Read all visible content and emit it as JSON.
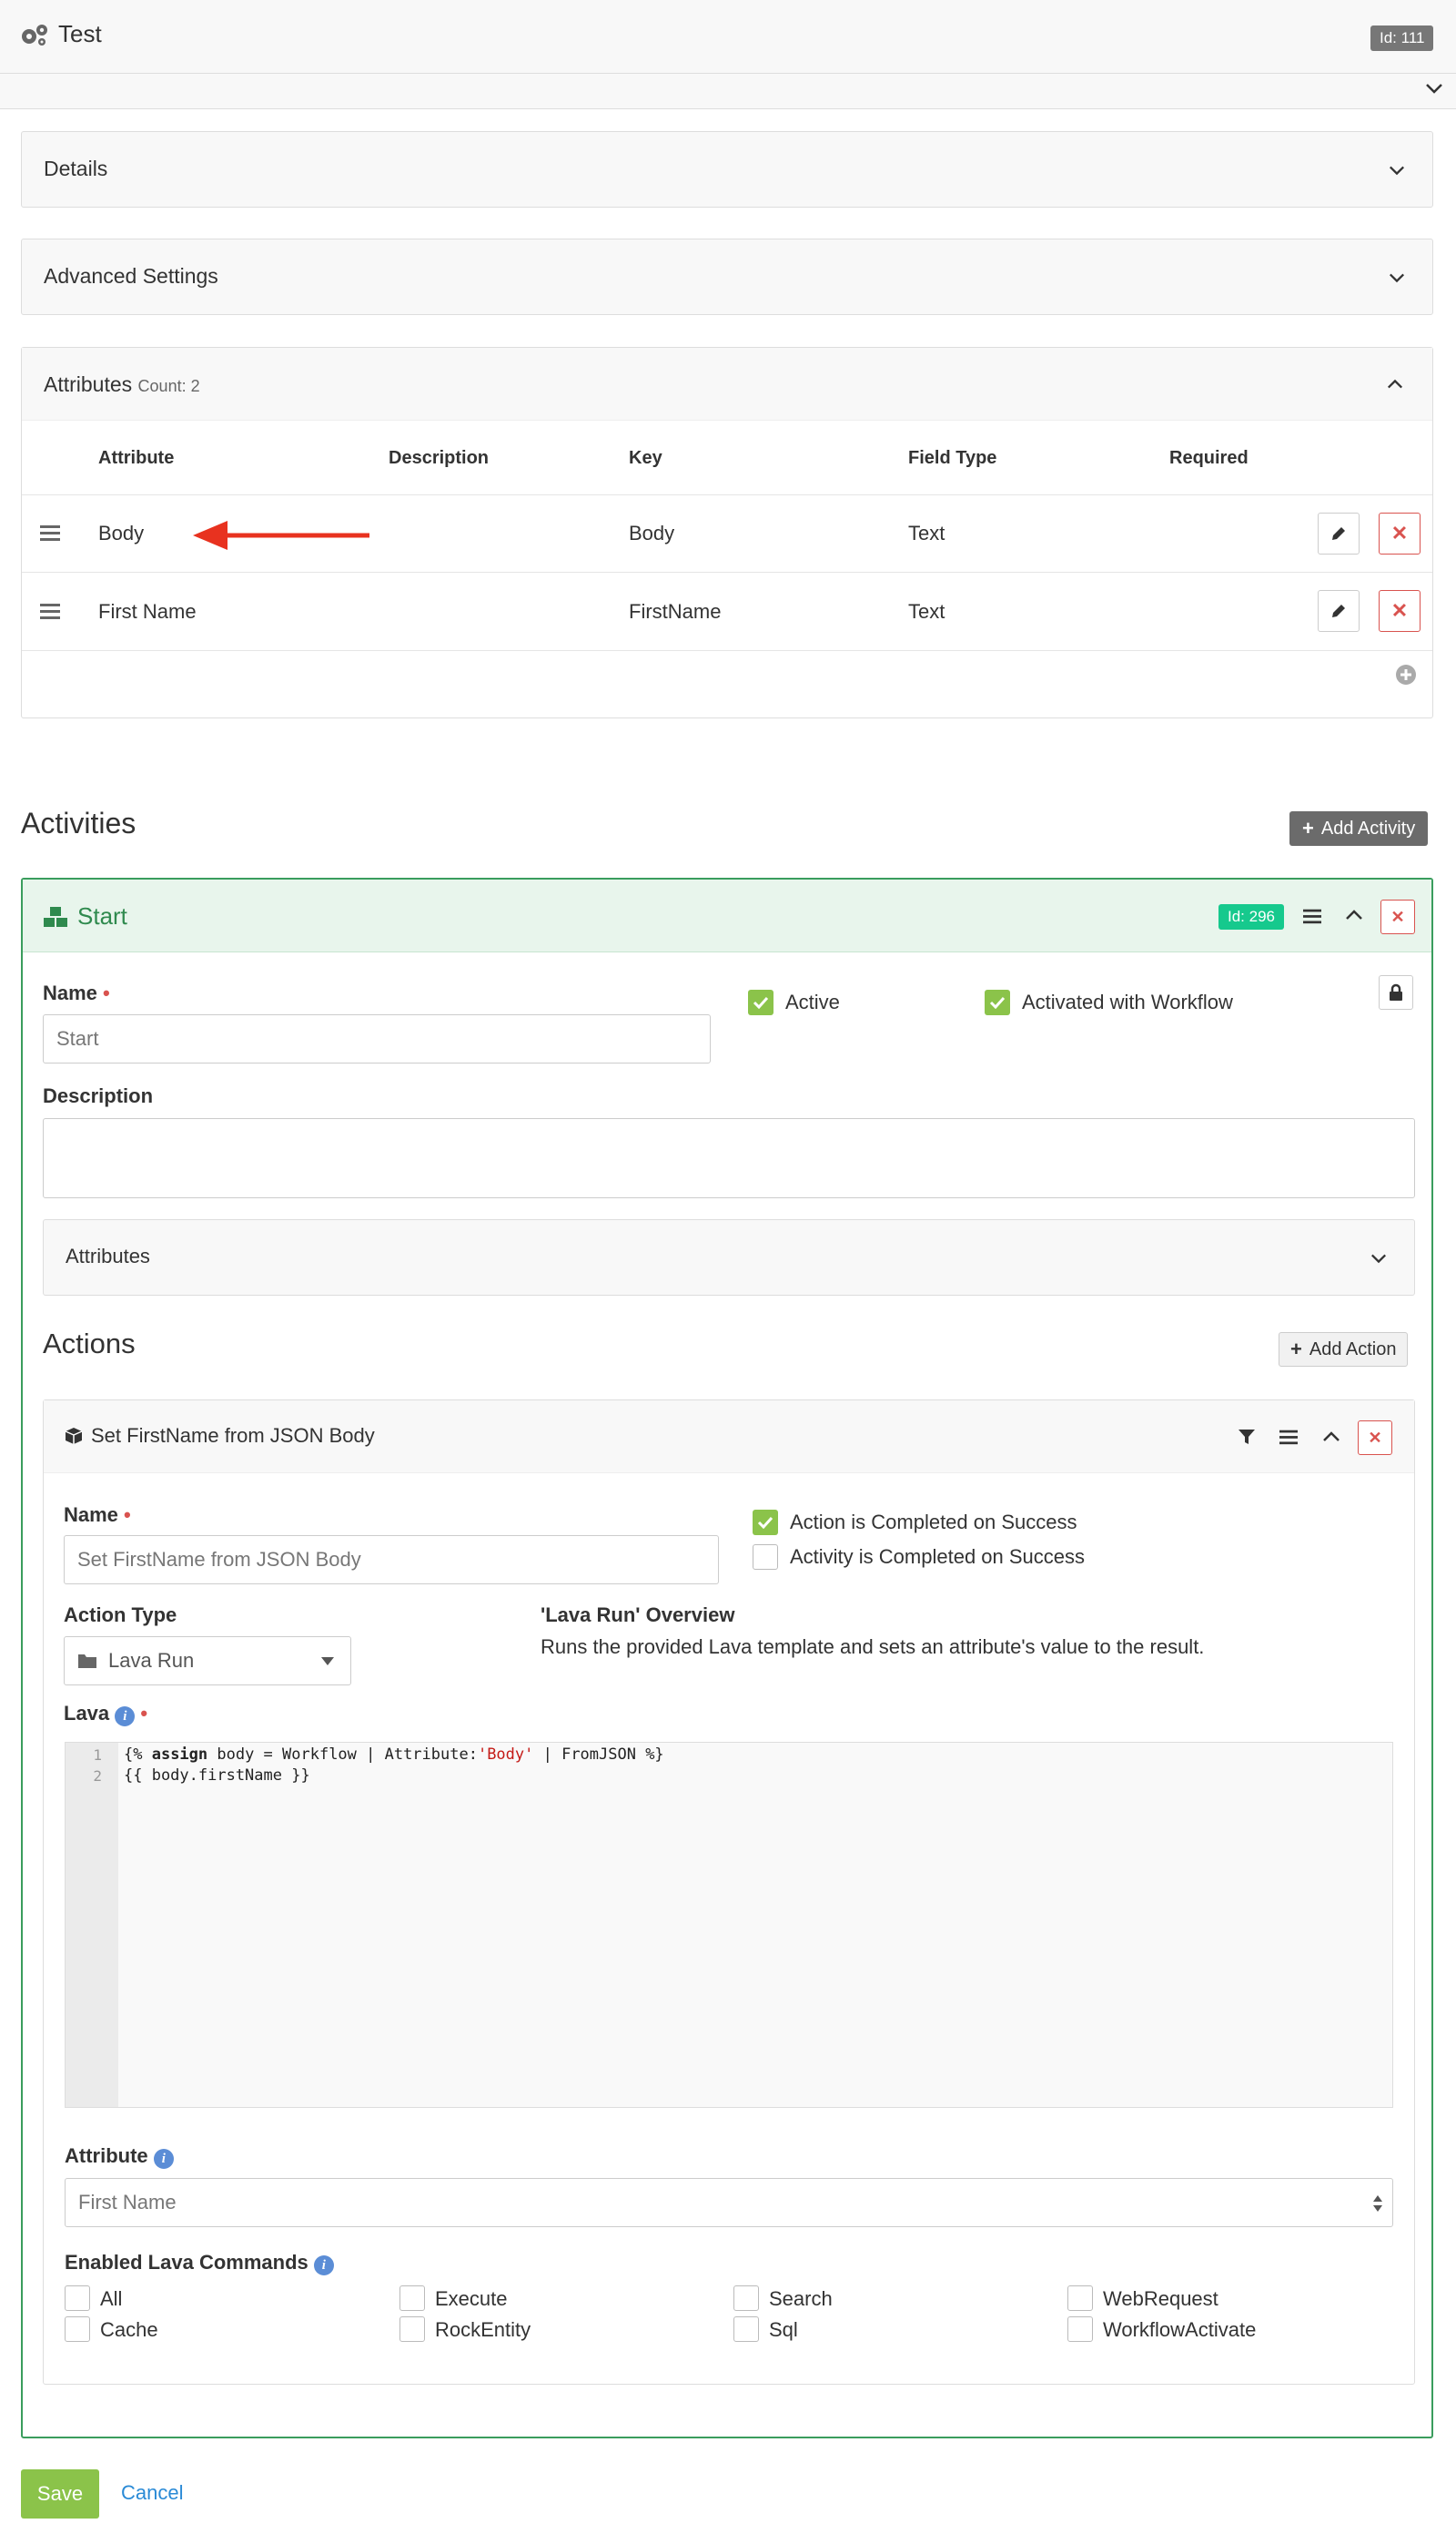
{
  "header": {
    "title": "Test",
    "id_badge": "Id: 111"
  },
  "panels": {
    "details": "Details",
    "advanced": "Advanced Settings",
    "attributes_title": "Attributes",
    "attributes_count": "Count: 2"
  },
  "attr_table": {
    "headers": [
      "Attribute",
      "Description",
      "Key",
      "Field Type",
      "Required"
    ],
    "rows": [
      {
        "attribute": "Body",
        "description": "",
        "key": "Body",
        "field_type": "Text"
      },
      {
        "attribute": "First Name",
        "description": "",
        "key": "FirstName",
        "field_type": "Text"
      }
    ]
  },
  "activities": {
    "title": "Activities",
    "add_label": "Add Activity",
    "activity": {
      "name": "Start",
      "id_badge": "Id: 296",
      "name_label": "Name",
      "name_value": "Start",
      "active_label": "Active",
      "activated_label": "Activated with Workflow",
      "description_label": "Description",
      "attributes_label": "Attributes"
    }
  },
  "actions": {
    "title": "Actions",
    "add_label": "Add Action",
    "action": {
      "title": "Set FirstName from JSON Body",
      "name_label": "Name",
      "name_value": "Set FirstName from JSON Body",
      "completed_success": "Action is Completed on Success",
      "activity_completed": "Activity is Completed on Success",
      "type_label": "Action Type",
      "type_value": "Lava Run",
      "overview_title": "'Lava Run' Overview",
      "overview_text": "Runs the provided Lava template and sets an attribute's value to the result.",
      "lava_label": "Lava",
      "code_lines": [
        {
          "num": "1",
          "pre": "{% ",
          "kw": "assign",
          "mid": " body = Workflow | Attribute:",
          "str": "'Body'",
          "post": " | FromJSON %}"
        },
        {
          "num": "2",
          "text": "{{ body.firstName }}"
        }
      ],
      "attribute_label": "Attribute",
      "attribute_value": "First Name",
      "enabled_label": "Enabled Lava Commands",
      "commands": [
        "All",
        "Execute",
        "Search",
        "WebRequest",
        "Cache",
        "RockEntity",
        "Sql",
        "WorkflowActivate"
      ]
    }
  },
  "footer": {
    "save": "Save",
    "cancel": "Cancel"
  }
}
